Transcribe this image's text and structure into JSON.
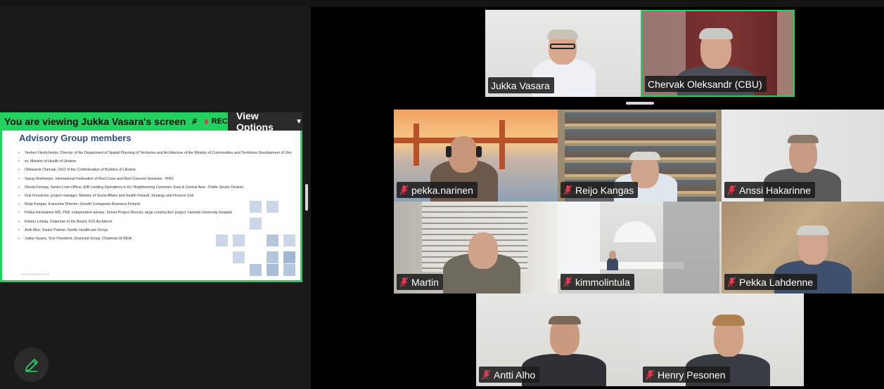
{
  "banner": {
    "viewing_text": "You are viewing  Jukka Vasara's screen",
    "rec_label": "REC",
    "view_options_label": "View Options",
    "mic_icon": "mic-muted-icon",
    "chevron_icon": "chevron-down-icon"
  },
  "slide": {
    "title": "Advisory Group members",
    "items": [
      "Yevhen Fleshchenko, Director of the Department of Spatial Planning of Territories and Architecture of the Ministry of Communities and Territories Development of Ukraine",
      "xx, Ministry of Health of Ukraine",
      "Oleksandr Chervak, CEO of the Confederation of Builders of Ukraine",
      "Sanay Mukherjee, International Federation of Red Cross and Red Crescent Societies - IFRC",
      "Olesia Feringa, Senior Loan Officer, EIB Lending Operations in EU Neighbouring Countries: East & Central Asia - Public Sector Division",
      "Outi Forsstrom, project manager, Ministry of Social Affairs and Health Finland, Strategy and Finance Unit",
      "Reijo Kangas, Executive Director, Growth Companies Business Finland",
      "Pekka Hirvelainen MD, PhD, independent adviser, former Project Director, large construction project, Helsinki University Hospital",
      "Kimmo Lintula, Chairman of the Board, K2S Architects",
      "Antti Alho, Senior Partner, Nordic Healthcare Group",
      "Jukka Vasara, Vice President, Granlund Group, Chairman of INDA"
    ],
    "footer": "6.1.22     XX.XXX     XX.YX"
  },
  "participants": [
    {
      "name": "Jukka Vasara",
      "muted": false
    },
    {
      "name": "Chervak Oleksandr (CBU)",
      "muted": false,
      "active_speaker": true
    },
    {
      "name": "pekka.narinen",
      "muted": true
    },
    {
      "name": "Reijo Kangas",
      "muted": true
    },
    {
      "name": "Anssi Hakarinne",
      "muted": true
    },
    {
      "name": "Martin",
      "muted": true
    },
    {
      "name": "kimmolintula",
      "muted": true
    },
    {
      "name": "Pekka Lahdenne",
      "muted": true
    },
    {
      "name": "Antti Alho",
      "muted": true
    },
    {
      "name": "Henry Pesonen",
      "muted": true
    }
  ],
  "tools": {
    "annotate_icon": "pencil-icon"
  },
  "colors": {
    "accent_green": "#23d160",
    "rec_red": "#e8384f",
    "muted_red": "#e8384f",
    "slide_title_blue": "#2c4f82"
  }
}
